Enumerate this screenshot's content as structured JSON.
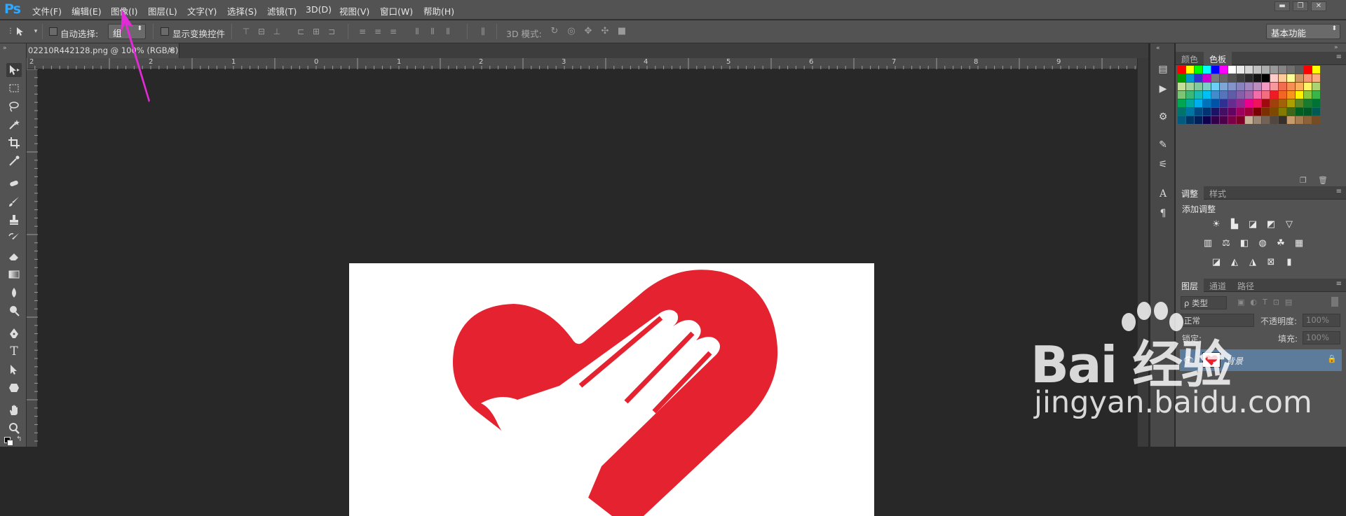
{
  "app": {
    "logo": "Ps"
  },
  "menu": {
    "items": [
      "文件(F)",
      "编辑(E)",
      "图像(I)",
      "图层(L)",
      "文字(Y)",
      "选择(S)",
      "滤镜(T)",
      "3D(D)",
      "视图(V)",
      "窗口(W)",
      "帮助(H)"
    ]
  },
  "window_controls": {
    "minimize": "▬",
    "restore": "❐",
    "close": "✕"
  },
  "options": {
    "auto_select_label": "自动选择:",
    "auto_select_value": "组",
    "show_transform_label": "显示变换控件",
    "mode3d_label": "3D 模式:",
    "workspace_value": "基本功能"
  },
  "document": {
    "tab_title": "02210R442128.png @ 100% (RGB/8)",
    "tab_close": "×"
  },
  "ruler": {
    "labels": [
      "2",
      "2",
      "1",
      "0",
      "1",
      "2",
      "3",
      "4",
      "5",
      "6",
      "7",
      "8",
      "9"
    ]
  },
  "swatches_panel": {
    "tabs": [
      "颜色",
      "色板"
    ],
    "colors": [
      [
        "#ff0000",
        "#ffff00",
        "#00ff00",
        "#00ffff",
        "#0000ff",
        "#ff00ff",
        "#ffffff",
        "#ebebeb",
        "#d6d6d6",
        "#c2c2c2",
        "#adadad",
        "#999999",
        "#858585",
        "#707070",
        "#5c5c5c",
        "#ff0000",
        "#ffff00"
      ],
      [
        "#009900",
        "#0099cc",
        "#3333cc",
        "#cc00cc",
        "#7a7a7a",
        "#666666",
        "#525252",
        "#3d3d3d",
        "#292929",
        "#141414",
        "#000000",
        "#ffcccc",
        "#ffcc99",
        "#ffff99",
        "#cc9966",
        "#f7977a",
        "#fbad82"
      ],
      [
        "#c4df9b",
        "#a3d39c",
        "#82ca9d",
        "#7bcdc8",
        "#6ecff6",
        "#7ea7d8",
        "#8493ca",
        "#8882be",
        "#a187be",
        "#bc8dbf",
        "#f49ac2",
        "#f6989d",
        "#f26c4f",
        "#f68e55",
        "#fbaf5c",
        "#fff467",
        "#acd372"
      ],
      [
        "#7cc576",
        "#3bb878",
        "#1abbb4",
        "#00bff3",
        "#438ccb",
        "#5574b9",
        "#605ca8",
        "#855fa8",
        "#a763a8",
        "#f06ea9",
        "#f26d7d",
        "#ed1c24",
        "#f26522",
        "#f7941d",
        "#fff200",
        "#8dc63f",
        "#39b54a"
      ],
      [
        "#00a651",
        "#00a99d",
        "#00aeef",
        "#0072bc",
        "#0054a6",
        "#2e3192",
        "#662d91",
        "#92278f",
        "#ec008c",
        "#ed145b",
        "#9e0b0f",
        "#a0410d",
        "#a36209",
        "#aba000",
        "#598527",
        "#197b30",
        "#007236"
      ],
      [
        "#00746b",
        "#0076a3",
        "#004a80",
        "#003471",
        "#1b1464",
        "#440e62",
        "#630460",
        "#9e005d",
        "#9e0039",
        "#790000",
        "#7b2e00",
        "#7d4900",
        "#827b00",
        "#406618",
        "#005e20",
        "#005826",
        "#005952"
      ],
      [
        "#005b7f",
        "#003663",
        "#002157",
        "#0d004c",
        "#32004b",
        "#4b0049",
        "#7b0046",
        "#7a0026",
        "#c7b299",
        "#998675",
        "#736357",
        "#534741",
        "#37302a",
        "#c69c6d",
        "#a67c52",
        "#8c6239",
        "#754c24"
      ]
    ]
  },
  "adjustments_panel": {
    "tabs": [
      "调整",
      "样式"
    ],
    "title": "添加调整"
  },
  "layers_panel": {
    "tabs": [
      "图层",
      "通道",
      "路径"
    ],
    "kind_label": "ρ 类型",
    "blend_mode": "正常",
    "opacity_label": "不透明度:",
    "opacity_value": "100%",
    "lock_label": "锁定:",
    "fill_label": "填充:",
    "fill_value": "100%",
    "layer_name": "背景"
  },
  "watermark": {
    "brand": "Bai 经验",
    "url": "jingyan.baidu.com"
  },
  "colors": {
    "accent_arrow": "#e02bd6",
    "heart_red": "#e52330",
    "ps_blue": "#31a8ff"
  }
}
